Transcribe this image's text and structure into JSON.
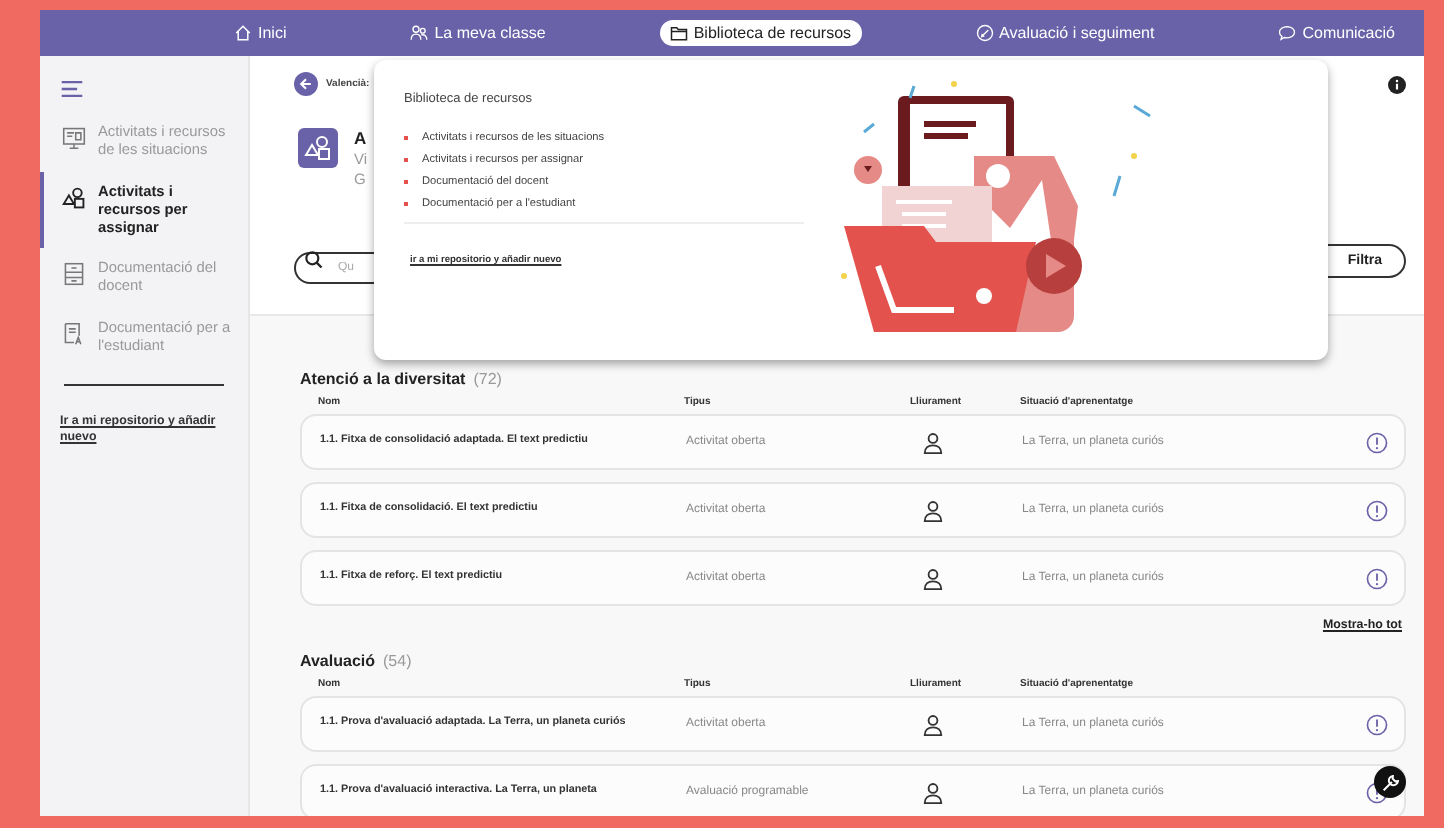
{
  "nav": [
    {
      "label": "Inici",
      "selected": false
    },
    {
      "label": "La meva classe",
      "selected": false
    },
    {
      "label": "Biblioteca de recursos",
      "selected": true
    },
    {
      "label": "Avaluació i seguiment",
      "selected": false
    },
    {
      "label": "Comunicació",
      "selected": false
    }
  ],
  "sidebar": {
    "items": [
      {
        "label": "Activitats i recursos de les situacions",
        "selected": false
      },
      {
        "label": "Activitats i recursos per assignar",
        "selected": true
      },
      {
        "label": "Documentació del docent",
        "selected": false
      },
      {
        "label": "Documentació per a l'estudiant",
        "selected": false
      }
    ],
    "link": "Ir a mi repositorio y añadir nuevo"
  },
  "header": {
    "back_label": "Valencià:",
    "title": "A",
    "subtitle_lines": [
      "Vi",
      "G"
    ]
  },
  "search": {
    "placeholder": "Qu"
  },
  "filter_button": "Filtra",
  "popup": {
    "title": "Biblioteca de recursos",
    "items": [
      "Activitats i recursos de les situacions",
      "Activitats i recursos per assignar",
      "Documentació del docent",
      "Documentació per a l'estudiant"
    ],
    "link": "ir a mi repositorio y añadir nuevo"
  },
  "sections": [
    {
      "title": "Atenció a la diversitat",
      "count": "(72)",
      "columns": [
        "Nom",
        "Tipus",
        "Lliurament",
        "Situació d'aprenentatge"
      ],
      "rows": [
        {
          "name": "1.1. Fitxa de consolidació adaptada. El text predictiu",
          "type": "Activitat oberta",
          "situation": "La Terra, un planeta curiós"
        },
        {
          "name": "1.1. Fitxa de consolidació. El text predictiu",
          "type": "Activitat oberta",
          "situation": "La Terra, un planeta curiós"
        },
        {
          "name": "1.1. Fitxa de reforç. El text predictiu",
          "type": "Activitat oberta",
          "situation": "La Terra, un planeta curiós"
        }
      ],
      "show_all": "Mostra-ho tot"
    },
    {
      "title": "Avaluació",
      "count": "(54)",
      "columns": [
        "Nom",
        "Tipus",
        "Lliurament",
        "Situació d'aprenentatge"
      ],
      "rows": [
        {
          "name": "1.1. Prova d'avaluació adaptada. La Terra, un planeta curiós",
          "type": "Activitat oberta",
          "situation": "La Terra, un planeta curiós"
        },
        {
          "name": "1.1. Prova d'avaluació interactiva. La Terra, un planeta",
          "type": "Avaluació programable",
          "situation": "La Terra, un planeta curiós"
        }
      ]
    }
  ]
}
